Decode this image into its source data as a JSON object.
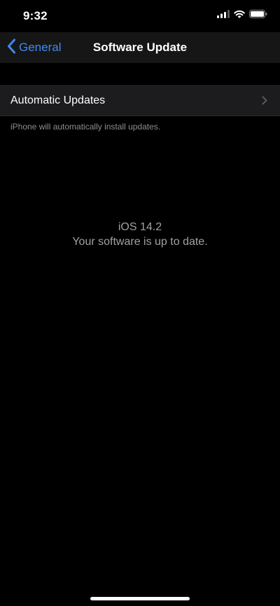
{
  "status_bar": {
    "time": "9:32",
    "icons": [
      "cellular-signal-icon",
      "wifi-icon",
      "battery-icon"
    ]
  },
  "nav": {
    "back_label": "General",
    "title": "Software Update",
    "accent_color": "#3d8af7"
  },
  "settings": {
    "automatic_updates_label": "Automatic Updates",
    "automatic_updates_footer": "iPhone will automatically install updates."
  },
  "update": {
    "version": "iOS 14.2",
    "status": "Your software is up to date."
  }
}
